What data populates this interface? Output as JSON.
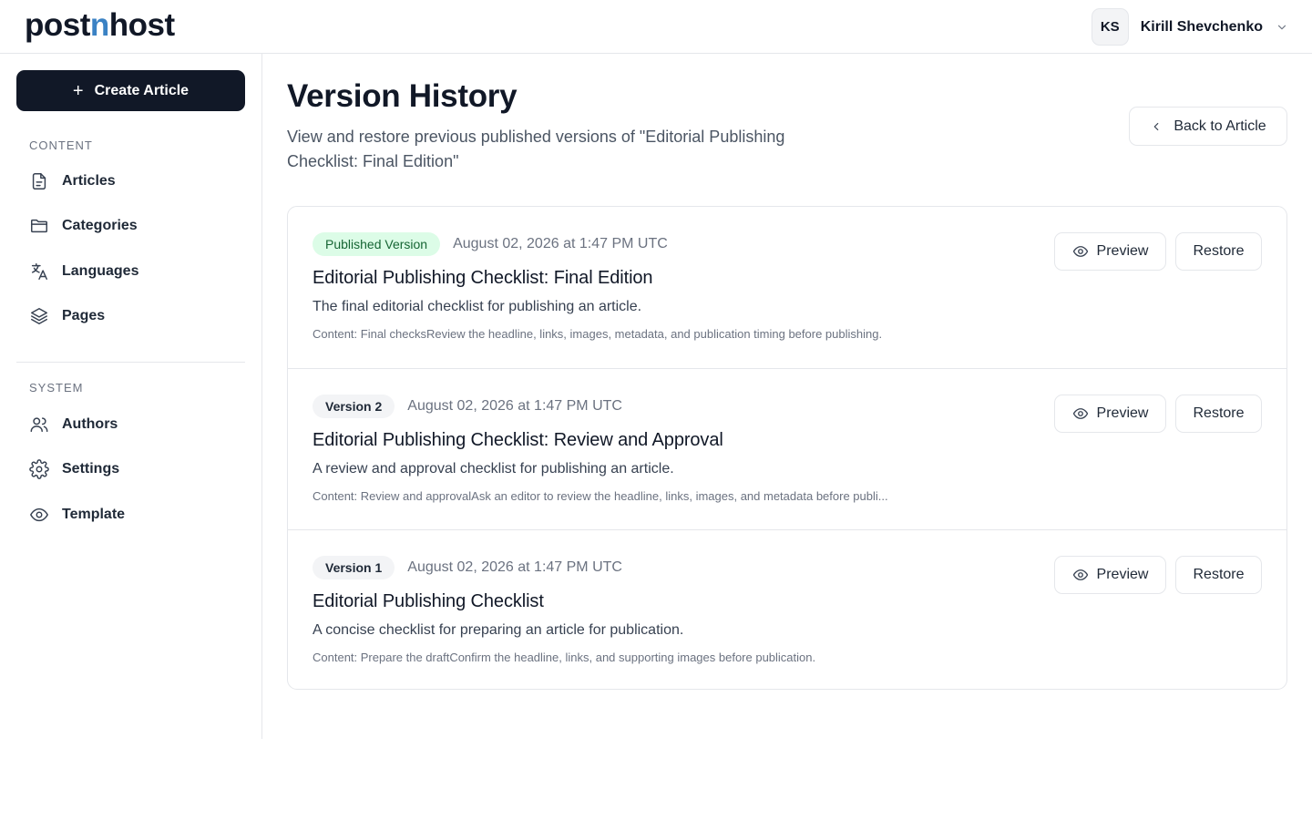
{
  "header": {
    "logo_part1": "post",
    "logo_part2": "n",
    "logo_part3": "host",
    "user_initials": "KS",
    "user_name": "Kirill Shevchenko"
  },
  "sidebar": {
    "create_label": "Create Article",
    "content_label": "CONTENT",
    "content_items": [
      {
        "label": "Articles",
        "icon": "document-icon"
      },
      {
        "label": "Categories",
        "icon": "folder-icon"
      },
      {
        "label": "Languages",
        "icon": "translate-icon"
      },
      {
        "label": "Pages",
        "icon": "layers-icon"
      }
    ],
    "system_label": "SYSTEM",
    "system_items": [
      {
        "label": "Authors",
        "icon": "users-icon"
      },
      {
        "label": "Settings",
        "icon": "gear-icon"
      },
      {
        "label": "Template",
        "icon": "eye-icon"
      }
    ]
  },
  "main": {
    "title": "Version History",
    "subtitle": "View and restore previous published versions of \"Editorial Publishing Checklist: Final Edition\"",
    "back_label": "Back to Article",
    "preview_label": "Preview",
    "restore_label": "Restore",
    "versions": [
      {
        "badge": "Published Version",
        "date": "August 02, 2026 at 1:47 PM UTC",
        "title": "Editorial Publishing Checklist: Final Edition",
        "description": "The final editorial checklist for publishing an article.",
        "content": "Content: Final checksReview the headline, links, images, metadata, and publication timing before publishing."
      },
      {
        "badge": "Version 2",
        "date": "August 02, 2026 at 1:47 PM UTC",
        "title": "Editorial Publishing Checklist: Review and Approval",
        "description": "A review and approval checklist for publishing an article.",
        "content": "Content: Review and approvalAsk an editor to review the headline, links, images, and metadata before publi..."
      },
      {
        "badge": "Version 1",
        "date": "August 02, 2026 at 1:47 PM UTC",
        "title": "Editorial Publishing Checklist",
        "description": "A concise checklist for preparing an article for publication.",
        "content": "Content: Prepare the draftConfirm the headline, links, and supporting images before publication."
      }
    ]
  },
  "colors": {
    "primary": "#111827",
    "logo_accent": "#3b82c4",
    "published_bg": "#dcfce7",
    "published_text": "#166534",
    "border": "#e5e7eb"
  }
}
